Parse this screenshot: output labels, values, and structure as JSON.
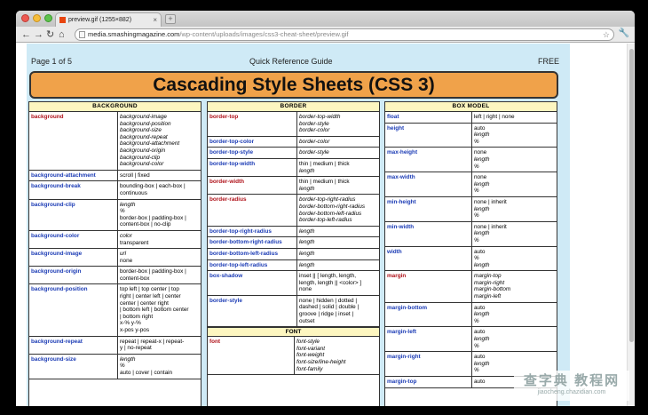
{
  "browser": {
    "tab_title": "preview.gif (1255×882)",
    "url_host": "media.smashingmagazine.com",
    "url_path": "/wp-content/uploads/images/css3-cheat-sheet/preview.gif",
    "new_tab": "+",
    "close_tab": "×"
  },
  "header": {
    "page": "Page 1 of 5",
    "guide": "Quick Reference Guide",
    "free": "FREE"
  },
  "title": "Cascading Style Sheets (CSS 3)",
  "columns": {
    "background": {
      "heading": "BACKGROUND",
      "rows": [
        {
          "prop": "background",
          "red": true,
          "values": [
            "background-image",
            "background-position",
            "background-size",
            "background-repeat",
            "background-attachment",
            "background-origin",
            "background-clip",
            "background-color"
          ]
        },
        {
          "prop": "background-attachment",
          "values": [
            "scroll | fixed"
          ]
        },
        {
          "prop": "background-break",
          "values": [
            "bounding-box | each-box |",
            "continuous"
          ]
        },
        {
          "prop": "background-clip",
          "values": [
            "length",
            "%",
            "border-box | padding-box |",
            "content-box | no-clip"
          ]
        },
        {
          "prop": "background-color",
          "values": [
            "color",
            "transparent"
          ]
        },
        {
          "prop": "background-image",
          "values": [
            "url",
            "none"
          ]
        },
        {
          "prop": "background-origin",
          "values": [
            "border-box | padding-box |",
            "content-box"
          ]
        },
        {
          "prop": "background-position",
          "values": [
            "top left | top center | top",
            "right | center left | center",
            "center | center right",
            "| bottom left | bottom center",
            "| bottom right",
            "x-% y-%",
            "x-pos y-pos"
          ]
        },
        {
          "prop": "background-repeat",
          "values": [
            "repeat | repeat-x | repeat-",
            "y | no-repeat"
          ]
        },
        {
          "prop": "background-size",
          "values": [
            "length",
            "%",
            "auto | cover | contain"
          ]
        }
      ]
    },
    "border": {
      "heading": "BORDER",
      "rows": [
        {
          "prop": "border-top",
          "red": true,
          "values": [
            "border-top-width",
            "border-style",
            "border-color"
          ]
        },
        {
          "prop": "border-top-color",
          "values": [
            "border-color"
          ]
        },
        {
          "prop": "border-top-style",
          "values": [
            "border-style"
          ]
        },
        {
          "prop": "border-top-width",
          "values": [
            "thin | medium | thick",
            "length"
          ]
        },
        {
          "prop": "border-width",
          "red": true,
          "values": [
            "thin | medium | thick",
            "length"
          ]
        },
        {
          "prop": "border-radius",
          "red": true,
          "values": [
            "border-top-right-radius",
            "border-bottom-right-radius",
            "border-bottom-left-radius",
            "border-top-left-radius"
          ]
        },
        {
          "prop": "border-top-right-radius",
          "values": [
            "length"
          ]
        },
        {
          "prop": "border-bottom-right-radius",
          "values": [
            "length"
          ]
        },
        {
          "prop": "border-bottom-left-radius",
          "values": [
            "length"
          ]
        },
        {
          "prop": "border-top-left-radius",
          "values": [
            "length"
          ]
        },
        {
          "prop": "box-shadow",
          "values": [
            "inset || [ length, length,",
            "length, length || <color> ]",
            "none"
          ]
        },
        {
          "prop": "border-style",
          "values": [
            "none | hidden | dotted |",
            "dashed | solid | double |",
            "groove | ridge | inset |",
            "outset"
          ]
        }
      ],
      "font_heading": "FONT",
      "font_rows": [
        {
          "prop": "font",
          "red": true,
          "values": [
            "font-style",
            "font-variant",
            "font-weight",
            "font-size/line-height",
            "font-family"
          ]
        }
      ]
    },
    "boxmodel": {
      "heading": "BOX MODEL",
      "rows": [
        {
          "prop": "float",
          "values": [
            "left | right | none"
          ]
        },
        {
          "prop": "height",
          "values": [
            "auto",
            "length",
            "%"
          ]
        },
        {
          "prop": "max-height",
          "values": [
            "none",
            "length",
            "%"
          ]
        },
        {
          "prop": "max-width",
          "values": [
            "none",
            "length",
            "%"
          ]
        },
        {
          "prop": "min-height",
          "values": [
            "none | inherit",
            "length",
            "%"
          ]
        },
        {
          "prop": "min-width",
          "values": [
            "none | inherit",
            "length",
            "%"
          ]
        },
        {
          "prop": "width",
          "values": [
            "auto",
            "%",
            "length"
          ]
        },
        {
          "prop": "margin",
          "red": true,
          "values": [
            "margin-top",
            "margin-right",
            "margin-bottom",
            "margin-left"
          ]
        },
        {
          "prop": "margin-bottom",
          "values": [
            "auto",
            "length",
            "%"
          ]
        },
        {
          "prop": "margin-left",
          "values": [
            "auto",
            "length",
            "%"
          ]
        },
        {
          "prop": "margin-right",
          "values": [
            "auto",
            "length",
            "%"
          ]
        },
        {
          "prop": "margin-top",
          "values": [
            "auto"
          ]
        }
      ]
    }
  },
  "watermark": {
    "line1": "查字典 教程网",
    "line2": "jiaocheng.chazidian.com"
  }
}
